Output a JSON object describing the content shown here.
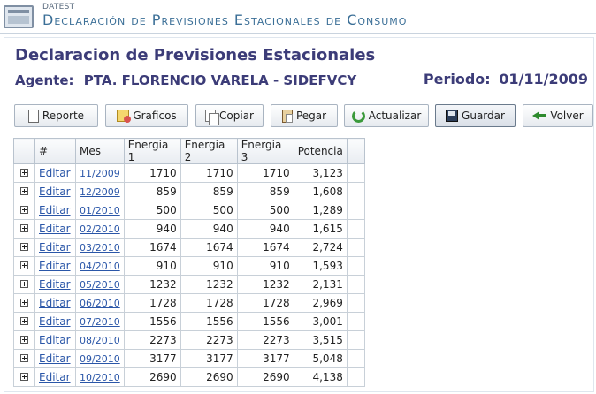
{
  "header": {
    "app_name": "DATEST",
    "app_title": "Declaración de Previsiones Estacionales de Consumo"
  },
  "page": {
    "title": "Declaracion de Previsiones Estacionales",
    "agente_label": "Agente:",
    "agente_value": "PTA. FLORENCIO VARELA - SIDEFVCY",
    "periodo_label": "Periodo:",
    "periodo_value": "01/11/2009"
  },
  "toolbar": {
    "reporte": "Reporte",
    "graficos": "Graficos",
    "copiar": "Copiar",
    "pegar": "Pegar",
    "actualizar": "Actualizar",
    "guardar": "Guardar",
    "volver": "Volver"
  },
  "table": {
    "headers": [
      "#",
      "Mes",
      "Energia 1",
      "Energia 2",
      "Energia 3",
      "Potencia"
    ],
    "rows": [
      {
        "edit": "Editar",
        "mes": "11/2009",
        "e1": "1710",
        "e2": "1710",
        "e3": "1710",
        "pot": "3,123"
      },
      {
        "edit": "Editar",
        "mes": "12/2009",
        "e1": "859",
        "e2": "859",
        "e3": "859",
        "pot": "1,608"
      },
      {
        "edit": "Editar",
        "mes": "01/2010",
        "e1": "500",
        "e2": "500",
        "e3": "500",
        "pot": "1,289"
      },
      {
        "edit": "Editar",
        "mes": "02/2010",
        "e1": "940",
        "e2": "940",
        "e3": "940",
        "pot": "1,615"
      },
      {
        "edit": "Editar",
        "mes": "03/2010",
        "e1": "1674",
        "e2": "1674",
        "e3": "1674",
        "pot": "2,724"
      },
      {
        "edit": "Editar",
        "mes": "04/2010",
        "e1": "910",
        "e2": "910",
        "e3": "910",
        "pot": "1,593"
      },
      {
        "edit": "Editar",
        "mes": "05/2010",
        "e1": "1232",
        "e2": "1232",
        "e3": "1232",
        "pot": "2,131"
      },
      {
        "edit": "Editar",
        "mes": "06/2010",
        "e1": "1728",
        "e2": "1728",
        "e3": "1728",
        "pot": "2,969"
      },
      {
        "edit": "Editar",
        "mes": "07/2010",
        "e1": "1556",
        "e2": "1556",
        "e3": "1556",
        "pot": "3,001"
      },
      {
        "edit": "Editar",
        "mes": "08/2010",
        "e1": "2273",
        "e2": "2273",
        "e3": "2273",
        "pot": "3,515"
      },
      {
        "edit": "Editar",
        "mes": "09/2010",
        "e1": "3177",
        "e2": "3177",
        "e3": "3177",
        "pot": "5,048"
      },
      {
        "edit": "Editar",
        "mes": "10/2010",
        "e1": "2690",
        "e2": "2690",
        "e3": "2690",
        "pot": "4,138"
      }
    ]
  }
}
